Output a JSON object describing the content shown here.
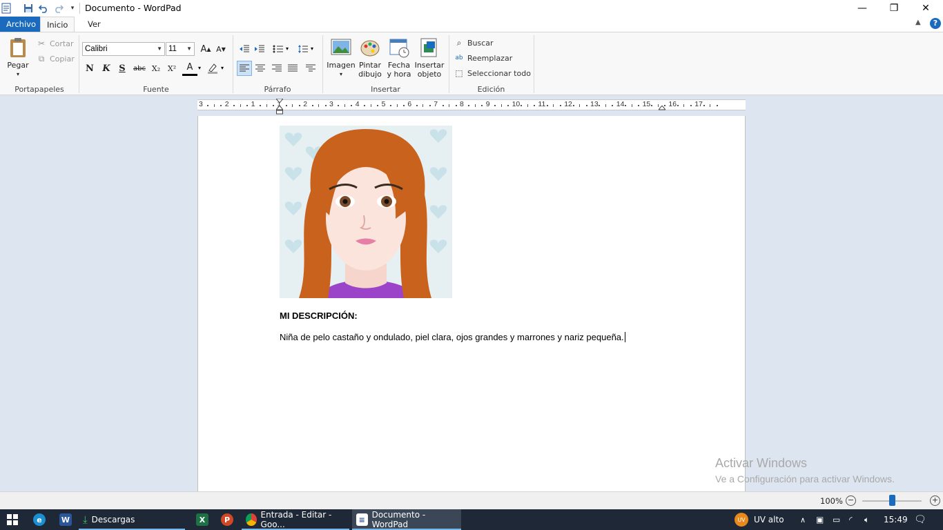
{
  "window": {
    "title": "Documento - WordPad",
    "minimize_glyph": "—",
    "restore_glyph": "❐",
    "close_glyph": "✕"
  },
  "quick_access": {
    "app_icon": "wordpad-icon",
    "save_icon": "save-icon",
    "undo_icon": "undo-icon",
    "redo_icon": "redo-icon",
    "customize_icon": "chevron-down-icon"
  },
  "tabs": [
    {
      "label": "Archivo"
    },
    {
      "label": "Inicio"
    },
    {
      "label": "Ver"
    }
  ],
  "ribbon": {
    "clipboard": {
      "paste": "Pegar",
      "cut": "Cortar",
      "copy": "Copiar",
      "group": "Portapapeles"
    },
    "font": {
      "family": "Calibri",
      "size": "11",
      "bold": "N",
      "italic": "K",
      "underline": "S",
      "strike": "abc",
      "subscript": "X₂",
      "superscript": "X²",
      "color_letter": "A",
      "group": "Fuente",
      "grow_glyph": "A",
      "shrink_glyph": "A"
    },
    "paragraph": {
      "group": "Párrafo"
    },
    "insert": {
      "image": "Imagen",
      "paint_line1": "Pintar",
      "paint_line2": "dibujo",
      "date_line1": "Fecha",
      "date_line2": "y hora",
      "object_line1": "Insertar",
      "object_line2": "objeto",
      "group": "Insertar"
    },
    "editing": {
      "find": "Buscar",
      "replace": "Reemplazar",
      "select_all": "Seleccionar todo",
      "group": "Edición"
    }
  },
  "ruler": {
    "labels": [
      "3",
      "2",
      "1",
      "1",
      "2",
      "3",
      "4",
      "5",
      "6",
      "7",
      "8",
      "9",
      "10",
      "11",
      "12",
      "13",
      "14",
      "15",
      "16",
      "17"
    ]
  },
  "document": {
    "heading": "MI DESCRIPCIÓN:",
    "body": "Niña de pelo castaño y ondulado, piel clara, ojos grandes y marrones y nariz pequeña."
  },
  "watermark": {
    "line1": "Activar Windows",
    "line2": "Ve a Configuración para activar Windows."
  },
  "status": {
    "zoom": "100%",
    "zoom_level": 0.5
  },
  "taskbar": {
    "downloads": "Descargas",
    "chrome": "Entrada - Editar - Goo...",
    "wordpad": "Documento - WordPad",
    "uv_badge": "UV",
    "uv_text": "UV alto",
    "time": "15:49"
  },
  "colors": {
    "accent": "#1a6bbd",
    "taskbar": "#1e2836"
  }
}
